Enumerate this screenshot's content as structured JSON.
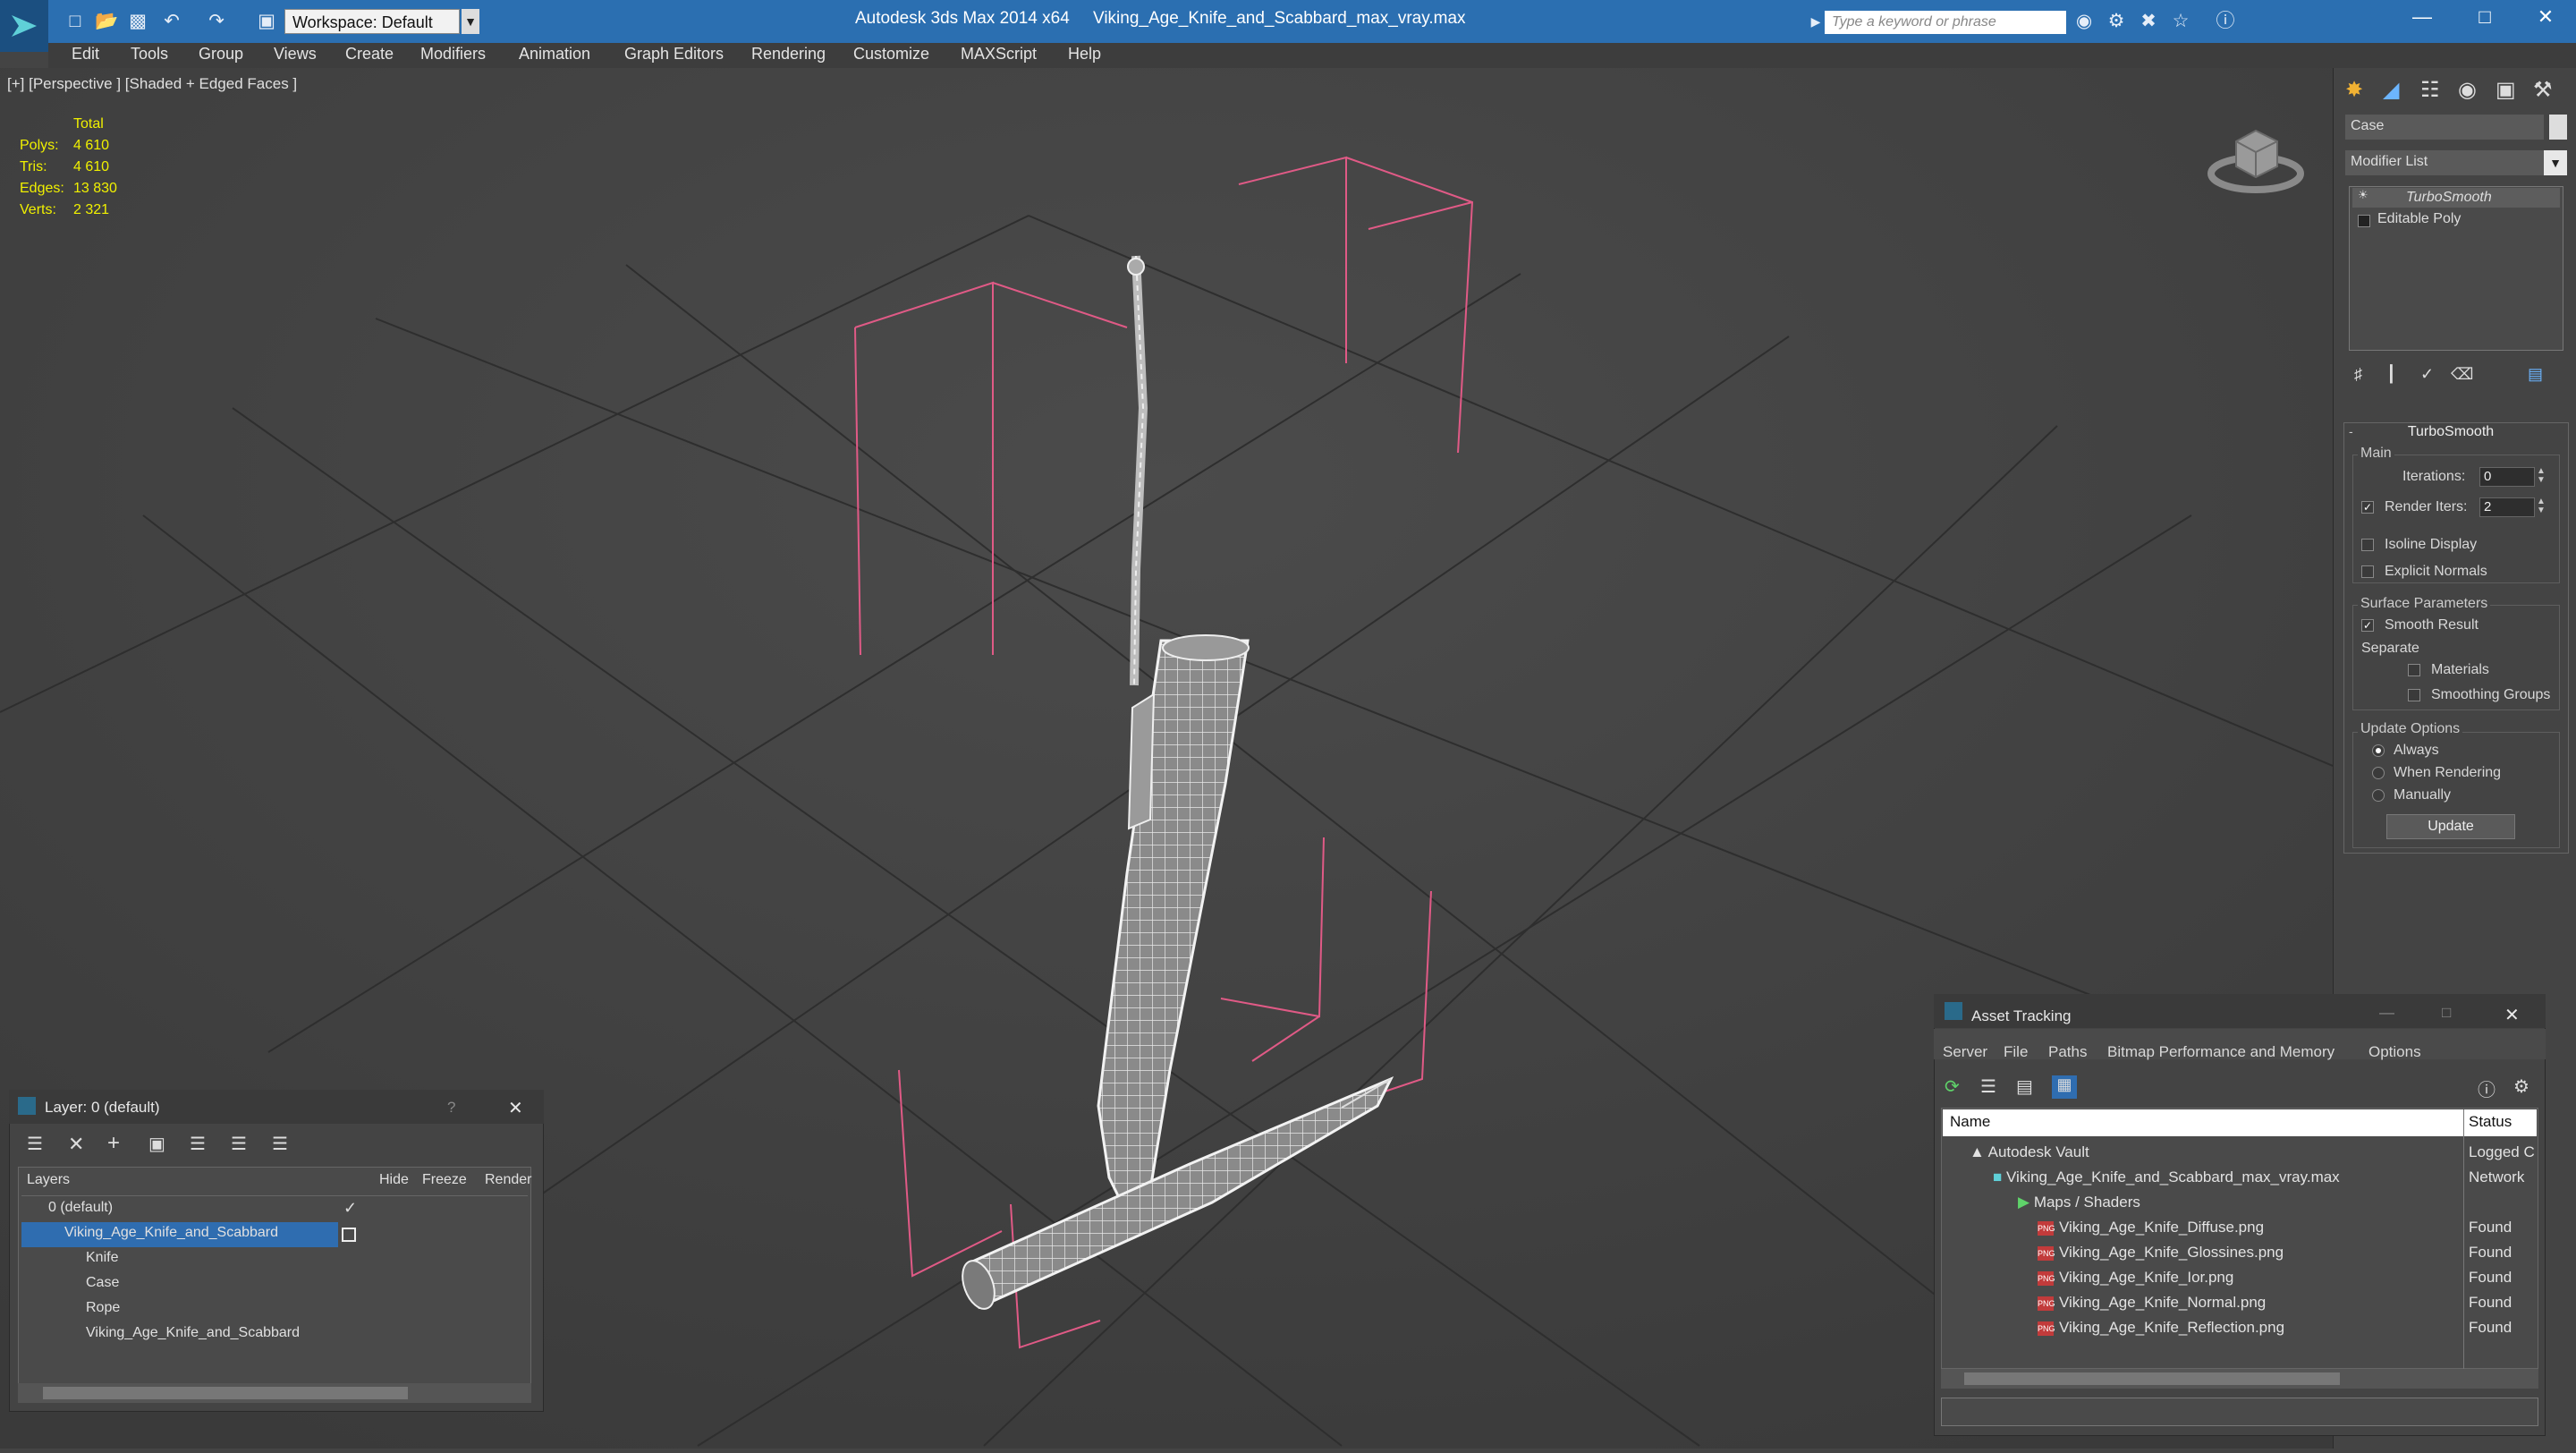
{
  "titlebar": {
    "workspace": "Workspace: Default",
    "app_title": "Autodesk 3ds Max  2014 x64",
    "file_title": "Viking_Age_Knife_and_Scabbard_max_vray.max",
    "search_placeholder": "Type a keyword or phrase",
    "accent": "#2b6fb1"
  },
  "menu": [
    "Edit",
    "Tools",
    "Group",
    "Views",
    "Create",
    "Modifiers",
    "Animation",
    "Graph Editors",
    "Rendering",
    "Customize",
    "MAXScript",
    "Help"
  ],
  "viewport": {
    "label": "[+] [Perspective ] [Shaded + Edged Faces ]",
    "stats_header": "Total",
    "stats": [
      {
        "label": "Polys:",
        "value": "4 610"
      },
      {
        "label": "Tris:",
        "value": "4 610"
      },
      {
        "label": "Edges:",
        "value": "13 830"
      },
      {
        "label": "Verts:",
        "value": "2 321"
      }
    ]
  },
  "command_panel": {
    "object_name": "Case",
    "modifier_list": "Modifier List",
    "stack": [
      "TurboSmooth",
      "Editable Poly"
    ],
    "rollout_title": "TurboSmooth",
    "main_group": "Main",
    "iterations_label": "Iterations:",
    "iterations_value": "0",
    "render_iters_label": "Render Iters:",
    "render_iters_value": "2",
    "isoline_label": "Isoline Display",
    "explicit_normals_label": "Explicit Normals",
    "surface_group": "Surface Parameters",
    "smooth_result_label": "Smooth Result",
    "separate_label": "Separate",
    "materials_label": "Materials",
    "smoothing_groups_label": "Smoothing Groups",
    "update_group": "Update Options",
    "always_label": "Always",
    "when_rendering_label": "When Rendering",
    "manually_label": "Manually",
    "update_button": "Update"
  },
  "layer_dialog": {
    "title": "Layer: 0 (default)",
    "help": "?",
    "col_layers": "Layers",
    "col_hide": "Hide",
    "col_freeze": "Freeze",
    "col_render": "Render",
    "rows": [
      "0 (default)",
      "Viking_Age_Knife_and_Scabbard",
      "Knife",
      "Case",
      "Rope",
      "Viking_Age_Knife_and_Scabbard"
    ]
  },
  "asset_tracking": {
    "title": "Asset Tracking",
    "menu": [
      "Server",
      "File",
      "Paths",
      "Bitmap Performance and Memory",
      "Options"
    ],
    "col_name": "Name",
    "col_status": "Status",
    "rows": [
      {
        "name": "Autodesk Vault",
        "status": "Logged C"
      },
      {
        "name": "Viking_Age_Knife_and_Scabbard_max_vray.max",
        "status": "Network"
      },
      {
        "name": "Maps / Shaders",
        "status": ""
      },
      {
        "name": "Viking_Age_Knife_Diffuse.png",
        "status": "Found"
      },
      {
        "name": "Viking_Age_Knife_Glossines.png",
        "status": "Found"
      },
      {
        "name": "Viking_Age_Knife_Ior.png",
        "status": "Found"
      },
      {
        "name": "Viking_Age_Knife_Normal.png",
        "status": "Found"
      },
      {
        "name": "Viking_Age_Knife_Reflection.png",
        "status": "Found"
      }
    ],
    "png_badge": "PNG"
  }
}
